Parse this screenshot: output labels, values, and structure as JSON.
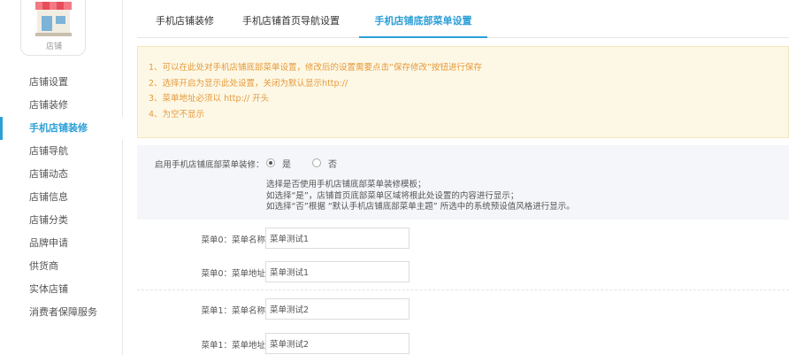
{
  "sidebar": {
    "logo_label": "店铺",
    "items": [
      {
        "label": "店铺设置"
      },
      {
        "label": "店铺装修"
      },
      {
        "label": "手机店铺装修",
        "active": true
      },
      {
        "label": "店铺导航"
      },
      {
        "label": "店铺动态"
      },
      {
        "label": "店铺信息"
      },
      {
        "label": "店铺分类"
      },
      {
        "label": "品牌申请"
      },
      {
        "label": "供货商"
      },
      {
        "label": "实体店铺"
      },
      {
        "label": "消费者保障服务"
      }
    ]
  },
  "tabs": [
    {
      "label": "手机店铺装修"
    },
    {
      "label": "手机店铺首页导航设置"
    },
    {
      "label": "手机店铺底部菜单设置",
      "active": true
    }
  ],
  "notice": {
    "lines": [
      "1、可以在此处对手机店铺底部菜单设置，修改后的设置需要点击“保存修改”按钮进行保存",
      "2、选择开启为显示此处设置，关闭为默认显示http://",
      "3、菜单地址必须以 http:// 开头",
      "4、为空不显示"
    ]
  },
  "enable": {
    "label": "启用手机店铺底部菜单装修：",
    "option_yes": "是",
    "option_no": "否",
    "selected": "是",
    "desc_lines": [
      "选择是否使用手机店铺底部菜单装修模板；",
      "如选择“是”，店铺首页底部菜单区域将根此处设置的内容进行显示；",
      "如选择“否”根据 “默认手机店铺底部菜单主题” 所选中的系统预设值风格进行显示。"
    ]
  },
  "menus": [
    {
      "name_label": "菜单0：菜单名称",
      "name_value": "菜单测试1",
      "url_label": "菜单0：菜单地址",
      "url_value": "菜单测试1"
    },
    {
      "name_label": "菜单1：菜单名称",
      "name_value": "菜单测试2",
      "url_label": "菜单1：菜单地址",
      "url_value": "菜单测试2"
    }
  ],
  "colors": {
    "accent": "#2c9fd6",
    "notice_text": "#e59a3c",
    "notice_bg": "#fdf8e6"
  }
}
